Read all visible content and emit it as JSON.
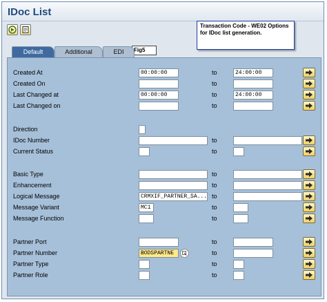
{
  "window": {
    "title": "IDoc List"
  },
  "annotation": {
    "fig_label": "Fig5",
    "callout_text": "Transaction Code - WE02 Options for IDoc list generation."
  },
  "tabs": [
    {
      "label": "Default",
      "active": true
    },
    {
      "label": "Additional",
      "active": false
    },
    {
      "label": "EDI",
      "active": false
    }
  ],
  "toolbar": {
    "execute_icon": "execute-icon",
    "variant_icon": "variant-icon"
  },
  "range_separator": "to",
  "fields": {
    "created_at": {
      "label": "Created At",
      "from": "00:00:00",
      "to": "24:00:00"
    },
    "created_on": {
      "label": "Created On",
      "from": "",
      "to": ""
    },
    "last_changed_at": {
      "label": "Last Changed at",
      "from": "00:00:00",
      "to": "24:00:00"
    },
    "last_changed_on": {
      "label": "Last Changed on",
      "from": "",
      "to": ""
    },
    "direction": {
      "label": "Direction",
      "value": ""
    },
    "idoc_number": {
      "label": "IDoc Number",
      "from": "",
      "to": ""
    },
    "current_status": {
      "label": "Current Status",
      "from": "",
      "to": ""
    },
    "basic_type": {
      "label": "Basic Type",
      "from": "",
      "to": ""
    },
    "enhancement": {
      "label": "Enhancement",
      "from": "",
      "to": ""
    },
    "logical_message": {
      "label": "Logical Message",
      "from": "CRMXIF_PARTNER_SA...",
      "to": ""
    },
    "message_variant": {
      "label": "Message Variant",
      "from": "MC1",
      "to": ""
    },
    "message_function": {
      "label": "Message Function",
      "from": "",
      "to": ""
    },
    "partner_port": {
      "label": "Partner Port",
      "from": "",
      "to": ""
    },
    "partner_number": {
      "label": "Partner Number",
      "from": "BODSPARTNE",
      "to": ""
    },
    "partner_type": {
      "label": "Partner Type",
      "from": "",
      "to": ""
    },
    "partner_role": {
      "label": "Partner Role",
      "from": "",
      "to": ""
    }
  }
}
